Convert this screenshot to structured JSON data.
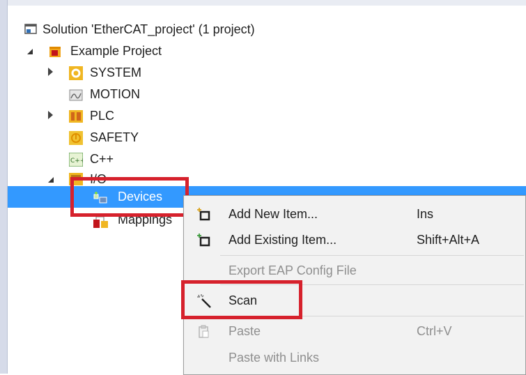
{
  "solution": {
    "label": "Solution 'EtherCAT_project' (1 project)",
    "icon": "solution-icon"
  },
  "project": {
    "label": "Example Project",
    "icon": "project-icon"
  },
  "tree_items": [
    {
      "label": "SYSTEM",
      "icon": "system-gear-icon"
    },
    {
      "label": "MOTION",
      "icon": "motion-icon"
    },
    {
      "label": "PLC",
      "icon": "plc-icon"
    },
    {
      "label": "SAFETY",
      "icon": "safety-icon"
    },
    {
      "label": "C++",
      "icon": "cpp-icon"
    },
    {
      "label": "I/O",
      "icon": "io-icon"
    },
    {
      "label": "Devices",
      "icon": "devices-icon"
    },
    {
      "label": "Mappings",
      "icon": "mappings-icon"
    }
  ],
  "context_menu": {
    "items": [
      {
        "label": "Add New Item...",
        "shortcut": "Ins",
        "icon": "add-new-item-icon",
        "enabled": true
      },
      {
        "label": "Add Existing Item...",
        "shortcut": "Shift+Alt+A",
        "icon": "add-existing-item-icon",
        "enabled": true
      },
      {
        "label": "Export EAP Config File",
        "shortcut": "",
        "icon": "",
        "enabled": false
      },
      {
        "label": "Scan",
        "shortcut": "",
        "icon": "magic-wand-icon",
        "enabled": true
      },
      {
        "label": "Paste",
        "shortcut": "Ctrl+V",
        "icon": "paste-icon",
        "enabled": false
      },
      {
        "label": "Paste with Links",
        "shortcut": "",
        "icon": "",
        "enabled": false
      }
    ]
  },
  "colors": {
    "selection": "#3399ff",
    "highlight_box": "#d6212c",
    "menu_bg": "#f2f2f2"
  }
}
